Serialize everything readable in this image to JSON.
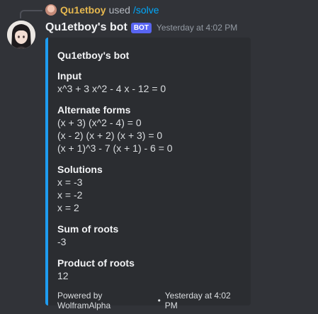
{
  "reply": {
    "user": "Qu1etboy",
    "used": "used",
    "command": "/solve"
  },
  "message": {
    "username": "Qu1etboy's bot",
    "badge": "BOT",
    "timestamp": "Yesterday at 4:02 PM"
  },
  "embed": {
    "title": "Qu1etboy's bot",
    "accent_color": "#1e9cf0",
    "fields": [
      {
        "name": "Input",
        "lines": [
          "x^3 + 3 x^2 - 4 x - 12 = 0"
        ]
      },
      {
        "name": "Alternate forms",
        "lines": [
          "(x + 3) (x^2 - 4) = 0",
          "(x - 2) (x + 2) (x + 3) = 0",
          "(x + 1)^3 - 7 (x + 1) - 6 = 0"
        ]
      },
      {
        "name": "Solutions",
        "lines": [
          "x = -3",
          "x = -2",
          "x = 2"
        ]
      },
      {
        "name": "Sum of roots",
        "lines": [
          "-3"
        ]
      },
      {
        "name": "Product of roots",
        "lines": [
          "12"
        ]
      }
    ],
    "footer_text": "Powered by WolframAlpha",
    "footer_separator": "•",
    "footer_timestamp": "Yesterday at 4:02 PM"
  }
}
